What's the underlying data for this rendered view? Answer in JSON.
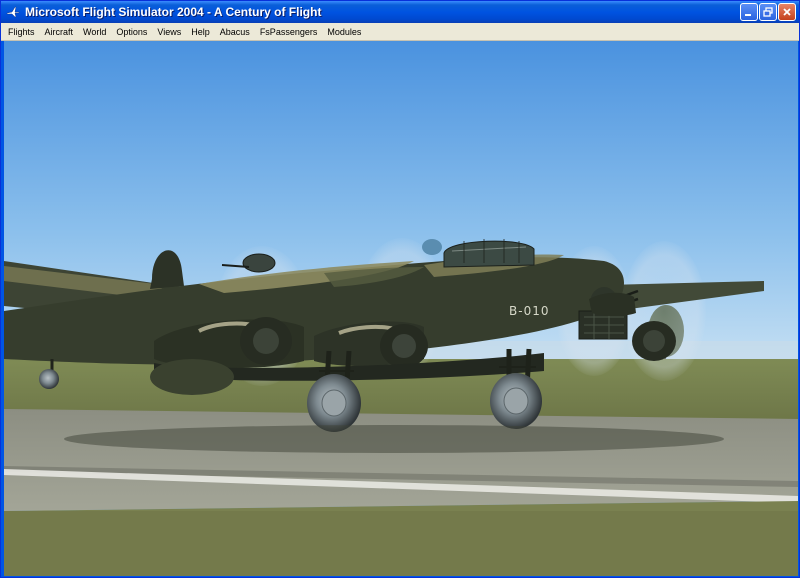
{
  "window": {
    "title": "Microsoft Flight Simulator 2004 - A Century of Flight",
    "icon": "plane-app-icon",
    "buttons": [
      "minimize",
      "restore",
      "close"
    ]
  },
  "menu": {
    "items": [
      "Flights",
      "Aircraft",
      "World",
      "Options",
      "Views",
      "Help",
      "Abacus",
      "FsPassengers",
      "Modules"
    ]
  },
  "scene": {
    "aircraft_code": "B-010",
    "colors": {
      "sky_top": "#4b93e0",
      "sky_bottom": "#b9daf2",
      "grass": "#7e8856",
      "runway": "#9a9c8e",
      "fuselage": "#343b2c",
      "camo": "#8a8a5c"
    }
  }
}
